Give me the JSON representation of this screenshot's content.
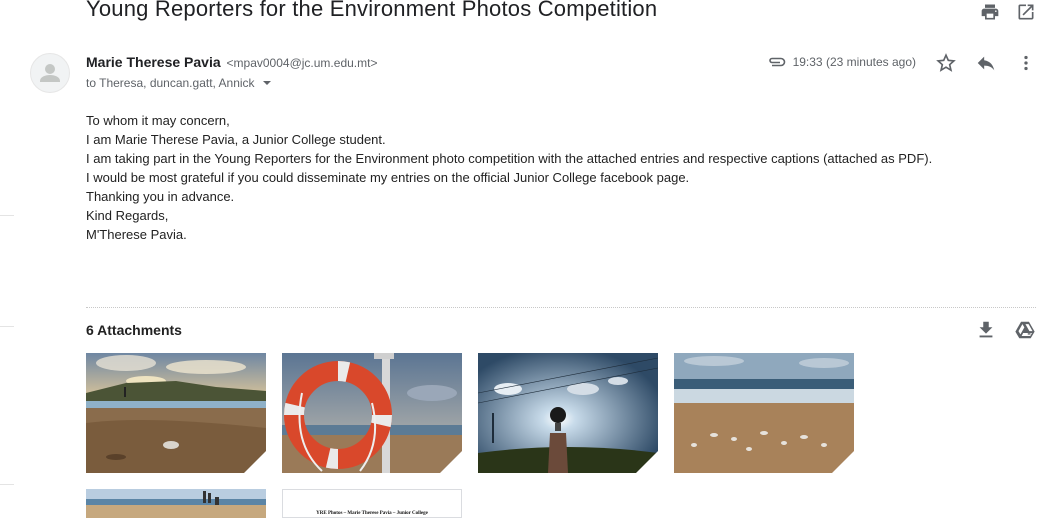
{
  "email": {
    "subject": "Young Reporters for the Environment Photos Competition",
    "sender_name": "Marie Therese Pavia",
    "sender_email": "<mpav0004@jc.um.edu.mt>",
    "recipients": "to Theresa, duncan.gatt, Annick",
    "time": "19:33 (23 minutes ago)",
    "body_lines": [
      "To whom it may concern,",
      "I am Marie Therese Pavia, a Junior College student.",
      "I am taking part in the Young Reporters for the Environment photo competition with the attached entries and respective captions (attached as PDF).",
      "I would be most grateful if you could disseminate my entries on the official Junior College facebook page.",
      "Thanking you in advance.",
      "Kind Regards,",
      "M'Therese Pavia."
    ]
  },
  "attachments": {
    "title": "6 Attachments",
    "pdf_header": "YRE Photos – Marie Therese Pavia – Junior College"
  },
  "icons": {
    "print": "print-icon",
    "open_new_window": "open-in-new-window-icon",
    "avatar": "person-icon",
    "attachment": "paperclip-icon",
    "star": "star-icon",
    "reply": "reply-icon",
    "more": "more-vertical-icon",
    "download": "download-icon",
    "drive": "google-drive-icon",
    "details": "chevron-down-icon"
  }
}
